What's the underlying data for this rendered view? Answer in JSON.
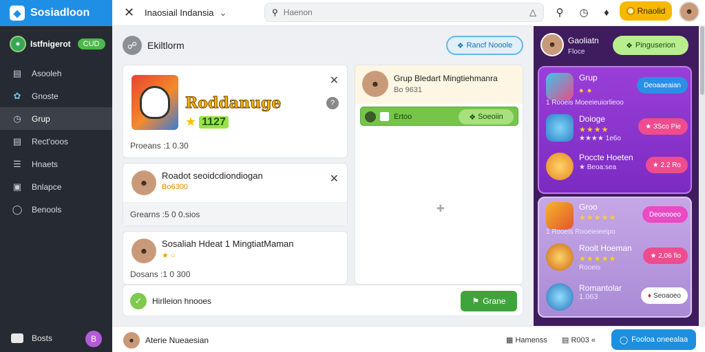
{
  "app": {
    "brand": "Sosiadloon",
    "title": "Inaosiail Indansia",
    "search_placeholder": "Haenon",
    "premium_label": "Rnaolid"
  },
  "sidebar": {
    "user_name": "Istfnigerot",
    "user_badge": "CUD",
    "items": [
      {
        "label": "Asooleh",
        "icon": "home-icon"
      },
      {
        "label": "Gnoste",
        "icon": "leaf-icon"
      },
      {
        "label": "Grup",
        "icon": "clock-icon"
      },
      {
        "label": "Rect'ooos",
        "icon": "document-icon"
      },
      {
        "label": "Hnaets",
        "icon": "list-icon"
      },
      {
        "label": "Bnlapce",
        "icon": "gift-icon"
      },
      {
        "label": "Benools",
        "icon": "settings-icon"
      }
    ],
    "active_index": 2,
    "bottom_label": "Bosts",
    "bottom_notif": "B"
  },
  "main": {
    "header_label": "Ekiltlorm",
    "share_label": "Rancf Nooole",
    "cards": [
      {
        "type": "game",
        "title": "Roddanuge",
        "score": "1127",
        "footer": "Proeans :1 0.30"
      },
      {
        "type": "person",
        "name": "Roadot seoidcdiondiogan",
        "sub": "Bo6300",
        "footer": "Grearns :5 0 0.sios"
      },
      {
        "type": "person",
        "name": "Sosaliah Hdeat 1 MingtiatMaman",
        "sub": "",
        "footer": "Dosans :1 0 300"
      }
    ],
    "complete_label": "Hirlleion hnooes",
    "complete_button": "Grane"
  },
  "group": {
    "name": "Grup Bledart Mingtiehmanra",
    "sub": "Bo 9631",
    "join_label": "Ertoo",
    "join_button": "Soeoiin"
  },
  "right": {
    "user_name": "Gaoliatn",
    "user_sub": "Floce",
    "head_button": "Pinguserion",
    "top_rewards": [
      {
        "title": "Grup",
        "stars": "★★★",
        "meta": "1 Rooeis  Moeeieuiorlieoo",
        "button": "Deoaaeaian",
        "button_color": "#2b8fe6"
      },
      {
        "title": "Doioge",
        "stars": "★★★★",
        "meta": "★★★★ 1e6o",
        "button": "★ 3Sco Pie",
        "button_color": "#ee4c8f"
      },
      {
        "title": "Poccte Hoeten",
        "stars": "",
        "meta": "★ Beoa:sea",
        "button": "★ 2.2 Ro",
        "button_color": "#ee4c8f"
      }
    ],
    "bottom_rewards": [
      {
        "title": "Groo",
        "stars": "★★★★★",
        "meta": "1 Rooeis  Rooeieieeipo",
        "button": "Deoeooeo",
        "button_color": "#e84bc3"
      },
      {
        "title": "Roolt Hoeman",
        "stars": "★★★★★",
        "meta": "Rooeis",
        "button": "★ 2.06 fio",
        "button_color": "#ee4c8f"
      },
      {
        "title": "Romantolar",
        "stars": "",
        "meta": "1.063",
        "button": "Seoaoeo",
        "button_color": "#ffffff"
      }
    ]
  },
  "statusbar": {
    "name": "Aterie Nueaesian",
    "item1": "Hamenss",
    "item2": "R003 «",
    "cta": "Fooloa oneealaa"
  }
}
